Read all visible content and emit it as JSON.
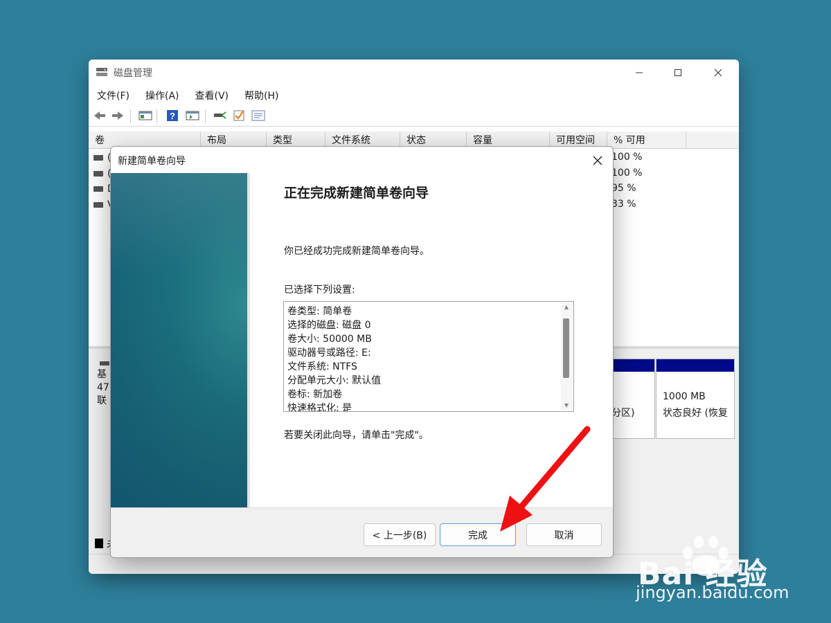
{
  "app": {
    "title": "磁盘管理"
  },
  "menu": [
    "文件(F)",
    "操作(A)",
    "查看(V)",
    "帮助(H)"
  ],
  "toolbar_icons": [
    "back-arrow-icon",
    "forward-arrow-icon",
    "console-tree-icon",
    "help-icon",
    "action-pane-icon",
    "connect-disk-icon",
    "check-icon",
    "properties-icon"
  ],
  "volume_list": {
    "columns": [
      "卷",
      "布局",
      "类型",
      "文件系统",
      "状态",
      "容量",
      "可用空间",
      "% 可用"
    ],
    "rows": [
      {
        "name": "(",
        "pct_free": "100 %"
      },
      {
        "name": "(",
        "pct_free": "100 %"
      },
      {
        "name": "D",
        "pct_free": "95 %"
      },
      {
        "name": "V",
        "pct_free": "33 %"
      }
    ]
  },
  "disk_map": {
    "disk_info": [
      "基",
      "47",
      "联"
    ],
    "partition_a": {
      "line": "分区)"
    },
    "partition_b": {
      "size": "1000 MB",
      "status": "状态良好 (恢复"
    },
    "legend_label": "未"
  },
  "wizard": {
    "title": "新建简单卷向导",
    "heading": "正在完成新建简单卷向导",
    "intro": "你已经成功完成新建简单卷向导。",
    "settings_label": "已选择下列设置:",
    "settings": [
      "卷类型: 简单卷",
      "选择的磁盘: 磁盘 0",
      "卷大小: 50000 MB",
      "驱动器号或路径: E:",
      "文件系统: NTFS",
      "分配单元大小: 默认值",
      "卷标: 新加卷",
      "快速格式化: 是"
    ],
    "close_hint": "若要关闭此向导，请单击\"完成\"。",
    "buttons": {
      "back": "< 上一步(B)",
      "finish": "完成",
      "cancel": "取消"
    }
  },
  "watermark": {
    "brand": "Bai 经验",
    "url": "jingyan.baidu.com"
  },
  "colors": {
    "desktop": "#2e7f9b",
    "partition_bar": "#000a88",
    "annotation_arrow": "#ee1111",
    "wizard_art": "#176378"
  }
}
